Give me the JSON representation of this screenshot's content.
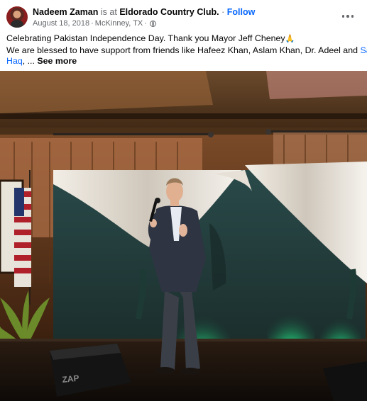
{
  "post": {
    "author_name": "Nadeem Zaman",
    "at_text": "is at",
    "place": "Eldorado Country Club.",
    "separator": "·",
    "follow_label": "Follow",
    "date": "August 18, 2018",
    "location": "McKinney, TX",
    "privacy_icon": "globe-icon",
    "more_icon": "more-options-icon",
    "text_line_1": "Celebrating Pakistan Independence Day.  Thank you Mayor Jeff Cheney",
    "emoji": "🙏",
    "text_line_2_start": "We are blessed to have support from friends like Hafeez Khan, Aslam Khan, Dr. Adeel and ",
    "link_1": "Sadaf",
    "link_2": "Haq",
    "text_line_3_rest": ", ... ",
    "see_more_label": "See more"
  },
  "colors": {
    "link": "#0866ff",
    "secondary_text": "#65676b",
    "primary_text": "#050505"
  }
}
